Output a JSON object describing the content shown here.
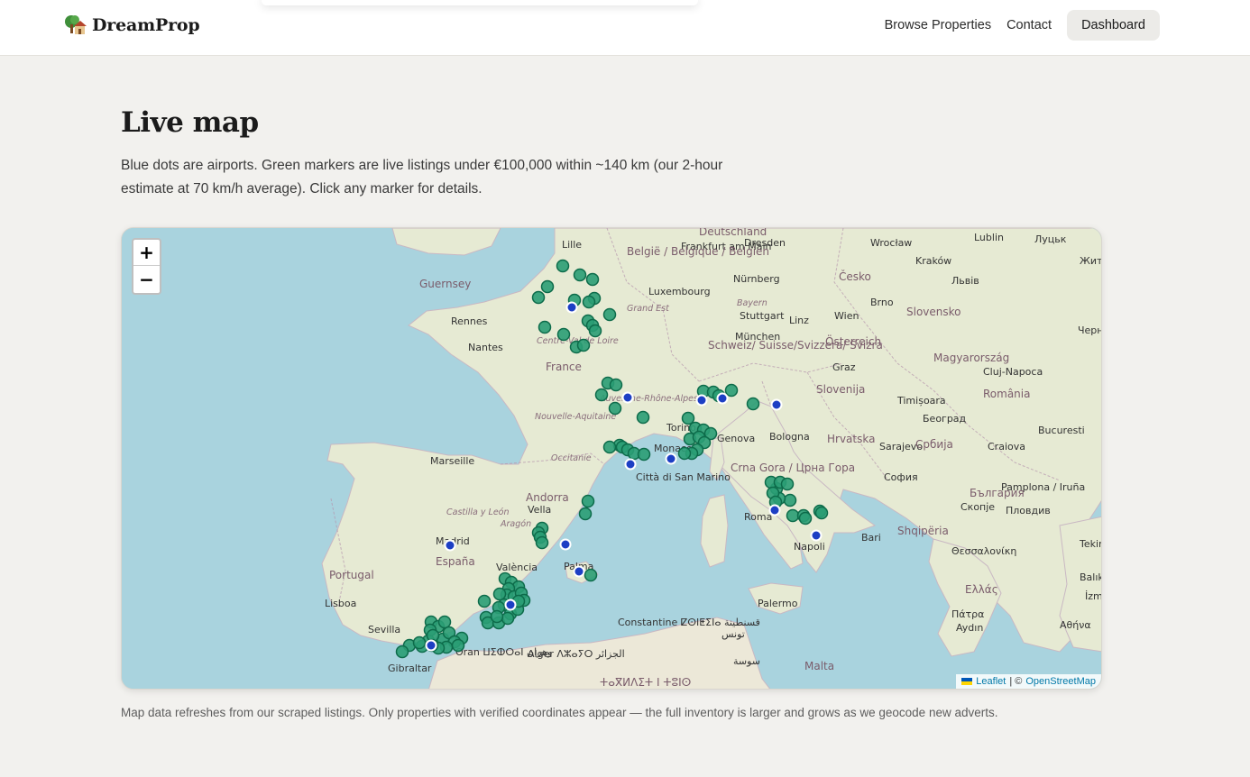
{
  "header": {
    "brand": "DreamProp",
    "nav": [
      "Browse Properties",
      "Contact"
    ],
    "dashboard_label": "Dashboard"
  },
  "page": {
    "title": "Live map",
    "intro": "Blue dots are airports. Green markers are live listings under €100,000 within ~140 km (our 2-hour estimate at 70 km/h average). Click any marker for details.",
    "footnote": "Map data refreshes from our scraped listings. Only properties with verified coordinates appear — the full inventory is larger and grows as we geocode new adverts."
  },
  "map": {
    "zoom_in": "+",
    "zoom_out": "−",
    "attribution": {
      "leaflet": "Leaflet",
      "separator": "| ©",
      "osm": "OpenStreetMap"
    },
    "colors": {
      "sea": "#a9d3de",
      "land": "#e9ecd9",
      "listing": "#2a9d74",
      "listing_border": "#0d6b4a",
      "airport": "#1d3fc4"
    },
    "labels": [
      {
        "text": "Deutschland",
        "kind": "country"
      },
      {
        "text": "Dresden",
        "kind": "city"
      },
      {
        "text": "Wrocław",
        "kind": "city"
      },
      {
        "text": "Lublin",
        "kind": "city"
      },
      {
        "text": "Луцьк",
        "kind": "city"
      },
      {
        "text": "Житомир",
        "kind": "city"
      },
      {
        "text": "Frankfurt am Main",
        "kind": "city"
      },
      {
        "text": "België / Belgique / Belgien",
        "kind": "country"
      },
      {
        "text": "Lille",
        "kind": "city"
      },
      {
        "text": "Guernsey",
        "kind": "country"
      },
      {
        "text": "Luxembourg",
        "kind": "city"
      },
      {
        "text": "Nürnberg",
        "kind": "city"
      },
      {
        "text": "Česko",
        "kind": "country"
      },
      {
        "text": "Kraków",
        "kind": "city"
      },
      {
        "text": "Львів",
        "kind": "city"
      },
      {
        "text": "Rennes",
        "kind": "city"
      },
      {
        "text": "Grand Est",
        "kind": "region"
      },
      {
        "text": "Stuttgart",
        "kind": "city"
      },
      {
        "text": "Bayern",
        "kind": "region"
      },
      {
        "text": "Linz",
        "kind": "city"
      },
      {
        "text": "Wien",
        "kind": "city"
      },
      {
        "text": "Brno",
        "kind": "city"
      },
      {
        "text": "Slovensko",
        "kind": "country"
      },
      {
        "text": "Чернівці",
        "kind": "city"
      },
      {
        "text": "Nantes",
        "kind": "city"
      },
      {
        "text": "Centre-Val de Loire",
        "kind": "region"
      },
      {
        "text": "München",
        "kind": "city"
      },
      {
        "text": "Österreich",
        "kind": "country"
      },
      {
        "text": "France",
        "kind": "country"
      },
      {
        "text": "Schweiz/ Suisse/Svizzera/ Svizra",
        "kind": "country"
      },
      {
        "text": "Graz",
        "kind": "city"
      },
      {
        "text": "Magyarország",
        "kind": "country"
      },
      {
        "text": "Cluj-Napoca",
        "kind": "city"
      },
      {
        "text": "Slovenija",
        "kind": "country"
      },
      {
        "text": "România",
        "kind": "country"
      },
      {
        "text": "Auvergne-Rhône-Alpes",
        "kind": "region"
      },
      {
        "text": "Timișoara",
        "kind": "city"
      },
      {
        "text": "Nouvelle-Aquitaine",
        "kind": "region"
      },
      {
        "text": "Torino",
        "kind": "city"
      },
      {
        "text": "Genova",
        "kind": "city"
      },
      {
        "text": "Bologna",
        "kind": "city"
      },
      {
        "text": "Hrvatska",
        "kind": "country"
      },
      {
        "text": "Београд",
        "kind": "city"
      },
      {
        "text": "Bucuresti",
        "kind": "city"
      },
      {
        "text": "Occitanie",
        "kind": "region"
      },
      {
        "text": "Monaco",
        "kind": "city"
      },
      {
        "text": "Sarajevo",
        "kind": "city"
      },
      {
        "text": "Србија",
        "kind": "country"
      },
      {
        "text": "Craiova",
        "kind": "city"
      },
      {
        "text": "Pamplona / Iruña",
        "kind": "city"
      },
      {
        "text": "Marseille",
        "kind": "city"
      },
      {
        "text": "Città di San Marino",
        "kind": "city"
      },
      {
        "text": "Crna Gora / Црна Гора",
        "kind": "country"
      },
      {
        "text": "София",
        "kind": "city"
      },
      {
        "text": "България",
        "kind": "country"
      },
      {
        "text": "Andorra",
        "kind": "country"
      },
      {
        "text": "Vella",
        "kind": "city"
      },
      {
        "text": "Castilla y León",
        "kind": "region"
      },
      {
        "text": "Aragón",
        "kind": "region"
      },
      {
        "text": "Roma",
        "kind": "city"
      },
      {
        "text": "Скопје",
        "kind": "city"
      },
      {
        "text": "Пловдив",
        "kind": "city"
      },
      {
        "text": "Madrid",
        "kind": "city"
      },
      {
        "text": "España",
        "kind": "country"
      },
      {
        "text": "Napoli",
        "kind": "city"
      },
      {
        "text": "Shqipëria",
        "kind": "country"
      },
      {
        "text": "Tekirdağ",
        "kind": "city"
      },
      {
        "text": "Bari",
        "kind": "city"
      },
      {
        "text": "Portugal",
        "kind": "country"
      },
      {
        "text": "Palma",
        "kind": "city"
      },
      {
        "text": "València",
        "kind": "city"
      },
      {
        "text": "Θεσσαλονίκη",
        "kind": "city"
      },
      {
        "text": "Balıkesir",
        "kind": "city"
      },
      {
        "text": "Lisboa",
        "kind": "city"
      },
      {
        "text": "Ελλάς",
        "kind": "country"
      },
      {
        "text": "İzmir",
        "kind": "city"
      },
      {
        "text": "Palermo",
        "kind": "city"
      },
      {
        "text": "Πάτρα",
        "kind": "city"
      },
      {
        "text": "Sevilla",
        "kind": "city"
      },
      {
        "text": "Constantine ⵇⵙⵏⵟⵉⵏⴰ قسنطينة",
        "kind": "city"
      },
      {
        "text": "Αθήνα",
        "kind": "city"
      },
      {
        "text": "Aydın",
        "kind": "city"
      },
      {
        "text": "Oran ⵡⵉⵀⵔⴰⵏ وهران",
        "kind": "city"
      },
      {
        "text": "Alger ⴷⵣⴰⵢⵔ الجزائر",
        "kind": "city"
      },
      {
        "text": "تونس",
        "kind": "city"
      },
      {
        "text": "Gibraltar",
        "kind": "city"
      },
      {
        "text": "سوسة",
        "kind": "city"
      },
      {
        "text": "Malta",
        "kind": "country"
      },
      {
        "text": "ⵜⴰⴳⵍⴷⵉⵜ ⵏ ⵜⵓⵏⵙ",
        "kind": "country"
      }
    ],
    "airports_count": 14,
    "listings_count": 150
  }
}
